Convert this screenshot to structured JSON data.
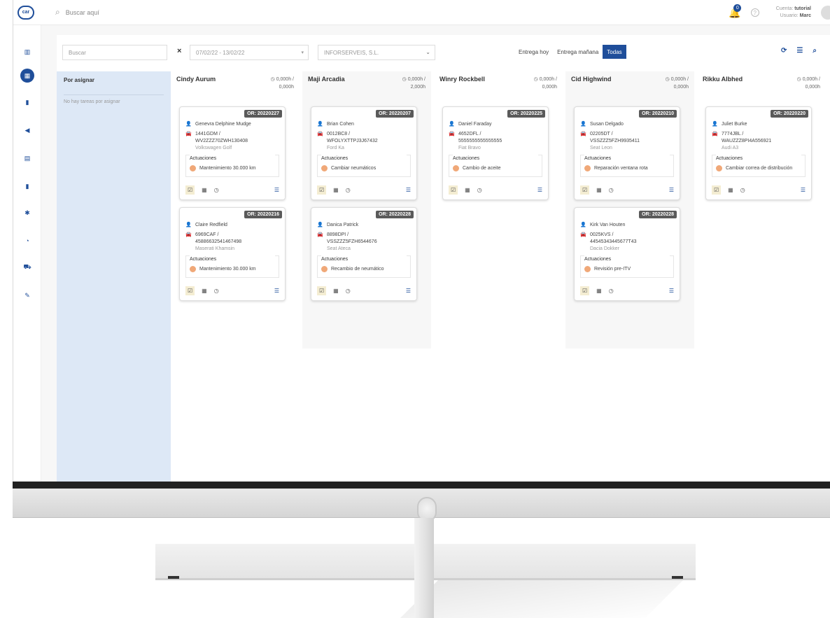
{
  "topbar": {
    "search_placeholder": "Buscar aquí",
    "logo_text": "car",
    "notifications_count": "0",
    "account_label": "Cuenta:",
    "account_value": "tutorial",
    "user_label": "Usuario:",
    "user_value": "Marc"
  },
  "filters": {
    "search_placeholder": "Buscar",
    "clear": "×",
    "date_range": "07/02/22 - 13/02/22",
    "company": "INFORSERVEIS, S.L.",
    "segments": [
      "Entrega hoy",
      "Entrega mañana",
      "Todas"
    ],
    "active_segment": "Todas"
  },
  "unassigned": {
    "title": "Por asignar",
    "empty": "No hay tareas por asignar"
  },
  "columns": [
    {
      "name": "Cindy Aurum",
      "hours1": "0,000h /",
      "hours2": "0,000h",
      "cards": [
        {
          "or": "OR: 20220227",
          "client": "Genevra Delphine Mudge",
          "plate": "1441GDM /",
          "vin": "WV2ZZZ70ZWH130408",
          "model": "Volkswagen Golf",
          "act_label": "Actuaciones",
          "action": "Mantenimiento 30.000 km"
        },
        {
          "or": "OR: 20220216",
          "client": "Claire Redfield",
          "plate": "6969CAF /",
          "vin": "45886632541467498",
          "model": "Maserati Khamsin",
          "act_label": "Actuaciones",
          "action": "Mantenimiento 30.000 km"
        }
      ]
    },
    {
      "name": "Maji Arcadia",
      "hours1": "0,000h /",
      "hours2": "2,000h",
      "cards": [
        {
          "or": "OR: 20220207",
          "client": "Brian Cohen",
          "plate": "0012BC8 /",
          "vin": "WFOLYXTTPJ3J67432",
          "model": "Ford Ka",
          "act_label": "Actuaciones",
          "action": "Cambiar neumáticos"
        },
        {
          "or": "OR: 20220228",
          "client": "Danica Patrick",
          "plate": "8898DPI /",
          "vin": "VSSZZZ5FZH6544676",
          "model": "Seat Ateca",
          "act_label": "Actuaciones",
          "action": "Recambio de neumático"
        }
      ]
    },
    {
      "name": "Winry Rockbell",
      "hours1": "0,000h /",
      "hours2": "0,000h",
      "cards": [
        {
          "or": "OR: 20220225",
          "client": "Daniel Faraday",
          "plate": "4652DFL /",
          "vin": "5555555555555555",
          "model": "Fiat Bravo",
          "act_label": "Actuaciones",
          "action": "Cambio de aceite"
        }
      ]
    },
    {
      "name": "Cid Highwind",
      "hours1": "0,000h /",
      "hours2": "0,000h",
      "cards": [
        {
          "or": "OR: 20220210",
          "client": "Susan Delgado",
          "plate": "02205DT /",
          "vin": "VSSZZZ5FZH9935411",
          "model": "Seat Leon",
          "act_label": "Actuaciones",
          "action": "Reparación ventana rota"
        },
        {
          "or": "OR: 20220228",
          "client": "Kirk Van Houten",
          "plate": "0025KVS /",
          "vin": "44545343445677T43",
          "model": "Dacia Dokker",
          "act_label": "Actuaciones",
          "action": "Revisión pre-ITV"
        }
      ]
    },
    {
      "name": "Rikku Albhed",
      "hours1": "0,000h /",
      "hours2": "0,000h",
      "cards": [
        {
          "or": "OR: 20220220",
          "client": "Juliet Burke",
          "plate": "7774JBL /",
          "vin": "WAUZZZ8PI4A556921",
          "model": "Audi A3",
          "act_label": "Actuaciones",
          "action": "Cambiar correa de distribución"
        }
      ]
    }
  ],
  "colors": {
    "accent": "#1f4e9a",
    "unassigned_bg": "#dde8f6",
    "or_badge": "#5a5a5a",
    "action_dot": "#f0a878"
  },
  "icons": [
    "search-icon",
    "bell-icon",
    "help-icon",
    "refresh-icon",
    "columns-icon",
    "search-icon",
    "user-icon",
    "car-icon",
    "check-calendar-icon",
    "calendar-icon",
    "clock-icon",
    "list-icon"
  ]
}
